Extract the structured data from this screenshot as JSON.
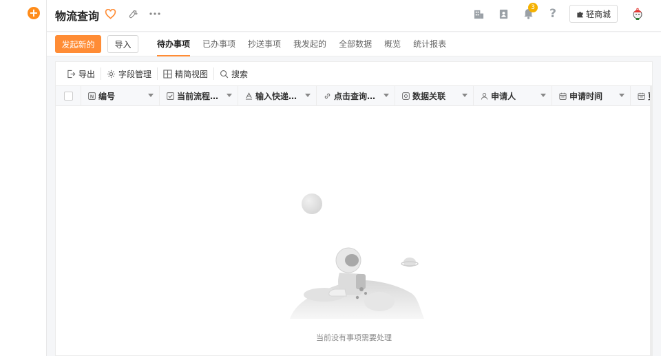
{
  "app": {
    "title": "物流查询"
  },
  "notifications": {
    "count": "3"
  },
  "header": {
    "mall_label": "轻商城"
  },
  "actions": {
    "create_label": "发起新的",
    "import_label": "导入"
  },
  "tabs": [
    {
      "label": "待办事项",
      "active": true
    },
    {
      "label": "已办事项",
      "active": false
    },
    {
      "label": "抄送事项",
      "active": false
    },
    {
      "label": "我发起的",
      "active": false
    },
    {
      "label": "全部数据",
      "active": false
    },
    {
      "label": "概览",
      "active": false
    },
    {
      "label": "统计报表",
      "active": false
    }
  ],
  "toolbar": {
    "export_label": "导出",
    "fields_label": "字段管理",
    "compact_label": "精简视图",
    "search_label": "搜索"
  },
  "columns": [
    {
      "label": "编号",
      "icon": "number-icon"
    },
    {
      "label": "当前流程…",
      "icon": "checkbox-icon"
    },
    {
      "label": "输入快递…",
      "icon": "text-icon"
    },
    {
      "label": "点击查询…",
      "icon": "link-icon"
    },
    {
      "label": "数据关联",
      "icon": "relation-icon"
    },
    {
      "label": "申请人",
      "icon": "user-icon"
    },
    {
      "label": "申请时间",
      "icon": "calendar-icon"
    },
    {
      "label": "更",
      "icon": "calendar-icon"
    }
  ],
  "empty_state": {
    "message": "当前没有事项需要处理"
  },
  "colors": {
    "accent": "#ff8c35",
    "badge": "#f5b100"
  }
}
